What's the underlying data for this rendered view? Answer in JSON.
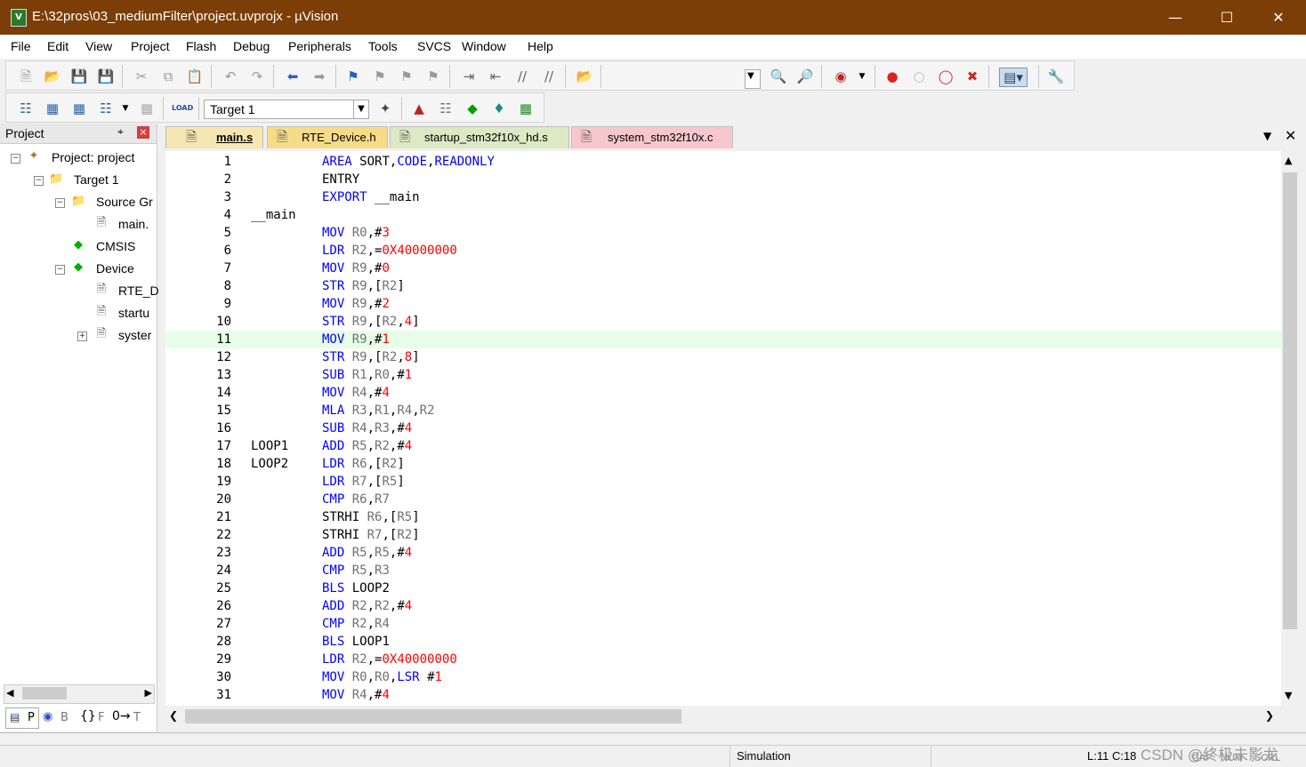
{
  "window": {
    "title": "E:\\32pros\\03_mediumFilter\\project.uvprojx - µVision",
    "app_icon": "V"
  },
  "menu": [
    "File",
    "Edit",
    "View",
    "Project",
    "Flash",
    "Debug",
    "Peripherals",
    "Tools",
    "SVCS",
    "Window",
    "Help"
  ],
  "toolbar2": {
    "target": "Target 1",
    "load_label": "LOAD"
  },
  "project_panel": {
    "title": "Project",
    "root": "Project: project",
    "target": "Target 1",
    "source_group": "Source Gr",
    "main_file": "main.",
    "cmsis": "CMSIS",
    "device": "Device",
    "rte": "RTE_D",
    "startup": "startu",
    "system": "syster",
    "bottom_tabs": [
      "P",
      "B",
      "F",
      "T"
    ]
  },
  "tabs": [
    {
      "label": "main.s",
      "active": true,
      "color": "#f6e7b2"
    },
    {
      "label": "RTE_Device.h",
      "active": false,
      "color": "#f7dc87"
    },
    {
      "label": "startup_stm32f10x_hd.s",
      "active": false,
      "color": "#dde8c4"
    },
    {
      "label": "system_stm32f10x.c",
      "active": false,
      "color": "#f7c7cc"
    }
  ],
  "code": [
    {
      "n": "1",
      "label": "",
      "text": "AREA SORT,CODE,READONLY"
    },
    {
      "n": "2",
      "label": "",
      "text": "ENTRY"
    },
    {
      "n": "3",
      "label": "",
      "text": "EXPORT __main"
    },
    {
      "n": "4",
      "label": "__main",
      "text": ""
    },
    {
      "n": "5",
      "label": "",
      "text": "MOV R0,#3"
    },
    {
      "n": "6",
      "label": "",
      "text": "LDR R2,=0X40000000"
    },
    {
      "n": "7",
      "label": "",
      "text": "MOV R9,#0"
    },
    {
      "n": "8",
      "label": "",
      "text": "STR R9,[R2]"
    },
    {
      "n": "9",
      "label": "",
      "text": "MOV R9,#2"
    },
    {
      "n": "10",
      "label": "",
      "text": "STR R9,[R2,4]"
    },
    {
      "n": "11",
      "label": "",
      "text": "MOV R9,#1"
    },
    {
      "n": "12",
      "label": "",
      "text": "STR R9,[R2,8]"
    },
    {
      "n": "13",
      "label": "",
      "text": "SUB R1,R0,#1"
    },
    {
      "n": "14",
      "label": "",
      "text": "MOV R4,#4"
    },
    {
      "n": "15",
      "label": "",
      "text": "MLA R3,R1,R4,R2"
    },
    {
      "n": "16",
      "label": "",
      "text": "SUB R4,R3,#4"
    },
    {
      "n": "17",
      "label": "LOOP1",
      "text": "ADD R5,R2,#4"
    },
    {
      "n": "18",
      "label": "LOOP2",
      "text": "LDR R6,[R2]"
    },
    {
      "n": "19",
      "label": "",
      "text": "LDR R7,[R5]"
    },
    {
      "n": "20",
      "label": "",
      "text": "CMP R6,R7"
    },
    {
      "n": "21",
      "label": "",
      "text": "STRHI R6,[R5]"
    },
    {
      "n": "22",
      "label": "",
      "text": "STRHI R7,[R2]"
    },
    {
      "n": "23",
      "label": "",
      "text": "ADD R5,R5,#4"
    },
    {
      "n": "24",
      "label": "",
      "text": "CMP R5,R3"
    },
    {
      "n": "25",
      "label": "",
      "text": "BLS LOOP2"
    },
    {
      "n": "26",
      "label": "",
      "text": "ADD R2,R2,#4"
    },
    {
      "n": "27",
      "label": "",
      "text": "CMP R2,R4"
    },
    {
      "n": "28",
      "label": "",
      "text": "BLS LOOP1"
    },
    {
      "n": "29",
      "label": "",
      "text": "LDR R2,=0X40000000"
    },
    {
      "n": "30",
      "label": "",
      "text": "MOV R0,R0,LSR #1"
    },
    {
      "n": "31",
      "label": "",
      "text": "MOV R4,#4"
    }
  ],
  "highlight_line": "11",
  "status": {
    "mode": "Simulation",
    "position": "L:11 C:18",
    "watermark": "CSDN @终极未影龙",
    "caps": "CAP",
    "num": "NUM",
    "scrl": "SCRL"
  },
  "colors": {
    "title_bg": "#7a3e06",
    "keyword": "#0000ff",
    "number": "#ff0000",
    "highlight": "#e6ffe6"
  }
}
